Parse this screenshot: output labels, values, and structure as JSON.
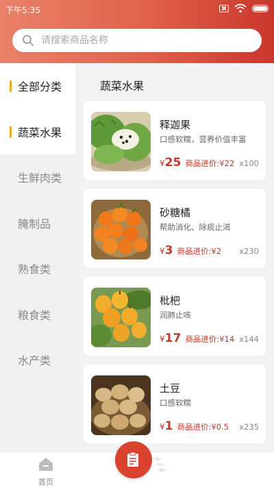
{
  "status_bar": {
    "time": "下午5:35"
  },
  "search": {
    "placeholder": "请搜索商品名称"
  },
  "sidebar": {
    "items": [
      {
        "label": "全部分类"
      },
      {
        "label": "蔬菜水果"
      },
      {
        "label": "生鲜肉类"
      },
      {
        "label": "腌制品"
      },
      {
        "label": "熟食类"
      },
      {
        "label": "粮食类"
      },
      {
        "label": "水产类"
      }
    ],
    "active_index": 1
  },
  "main": {
    "section_title": "蔬菜水果",
    "products": [
      {
        "name": "释迦果",
        "desc": "口感软糯，营养价值丰富",
        "currency": "¥",
        "price": "25",
        "cost_label": "商品进价:¥",
        "cost": "22",
        "qty": "x100"
      },
      {
        "name": "砂糖橘",
        "desc": "帮助消化、除痰止渴",
        "currency": "¥",
        "price": "3",
        "cost_label": "商品进价:¥",
        "cost": "2",
        "qty": "x230"
      },
      {
        "name": "枇杷",
        "desc": "润肺止咳",
        "currency": "¥",
        "price": "17",
        "cost_label": "商品进价:¥",
        "cost": "14",
        "qty": "x144"
      },
      {
        "name": "土豆",
        "desc": "口感软糯",
        "currency": "¥",
        "price": "1",
        "cost_label": "商品进价:¥",
        "cost": "0.5",
        "qty": "x235"
      }
    ]
  },
  "tabbar": {
    "home_label": "首页"
  },
  "colors": {
    "accent": "#d9432f",
    "price": "#c0392b",
    "indicator": "#f5a623"
  }
}
